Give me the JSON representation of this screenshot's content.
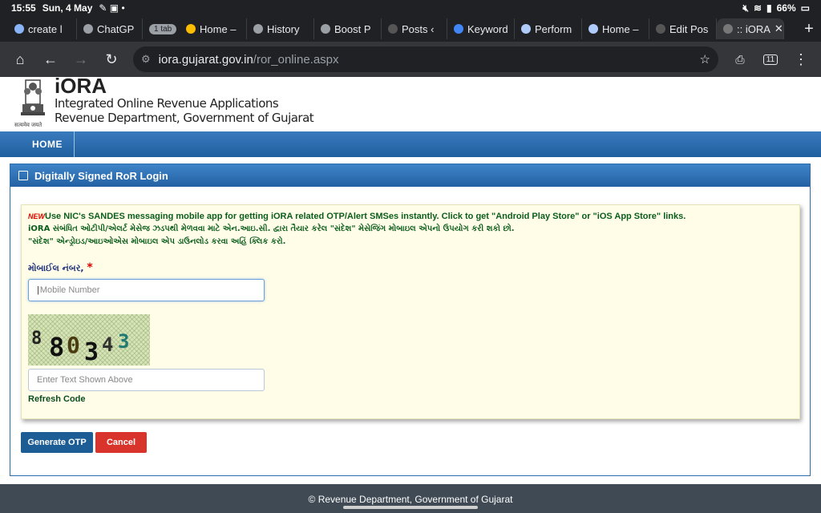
{
  "status": {
    "time": "15:55",
    "date": "Sun, 4 May",
    "battery": "66%"
  },
  "tabs": [
    {
      "label": "create l"
    },
    {
      "label": "ChatGP"
    },
    {
      "label": "1 tab"
    },
    {
      "label": "Home –"
    },
    {
      "label": "History"
    },
    {
      "label": "Boost P"
    },
    {
      "label": "Posts ‹"
    },
    {
      "label": "Keyword"
    },
    {
      "label": "Perform"
    },
    {
      "label": "Home –"
    },
    {
      "label": "Edit Pos"
    },
    {
      "label": ":: iORA"
    }
  ],
  "omnibox": {
    "domain": "iora.gujarat.gov.in",
    "path": "/ror_online.aspx",
    "tab_count": "11"
  },
  "header": {
    "app_name": "iORA",
    "line1": "Integrated Online Revenue Applications",
    "line2": "Revenue Department, Government of Gujarat",
    "emblem_caption": "सत्यमेव जयते"
  },
  "nav": {
    "home": "HOME"
  },
  "panel": {
    "title": "Digitally Signed RoR Login"
  },
  "notice": {
    "new_badge": "NEW",
    "english": "Use NIC's SANDES messaging mobile app for getting iORA related OTP/Alert SMSes instantly. Click to get \"Android Play Store\" or \"iOS App Store\" links.",
    "gujarati1": "iORA સંબંધિત ઓટીપી/એલર્ટ મેસેજ ઝડપથી મેળવવા માટે એન.આઇ.સી. દ્વારા તૈયાર કરેલ \"સંદેશ\" મેસેજિંગ મોબાઇલ એપનો ઉપયોગ કરી શકો છો.",
    "gujarati2": "\"સંદેશ\" એન્ડ્રોઇડ/આઇઓએસ મોબાઇલ એપ ડાઉનલોડ કરવા અહિં ક્લિક કરો."
  },
  "form": {
    "mobile_label": "મોબાઈલ નંબર,",
    "required_mark": "*",
    "mobile_placeholder": "Mobile Number",
    "captcha_text": "880343",
    "captcha_placeholder": "Enter Text Shown Above",
    "refresh_label": "Refresh Code"
  },
  "buttons": {
    "generate_otp": "Generate OTP",
    "cancel": "Cancel"
  },
  "footer": {
    "text": "© Revenue Department, Government of Gujarat"
  }
}
